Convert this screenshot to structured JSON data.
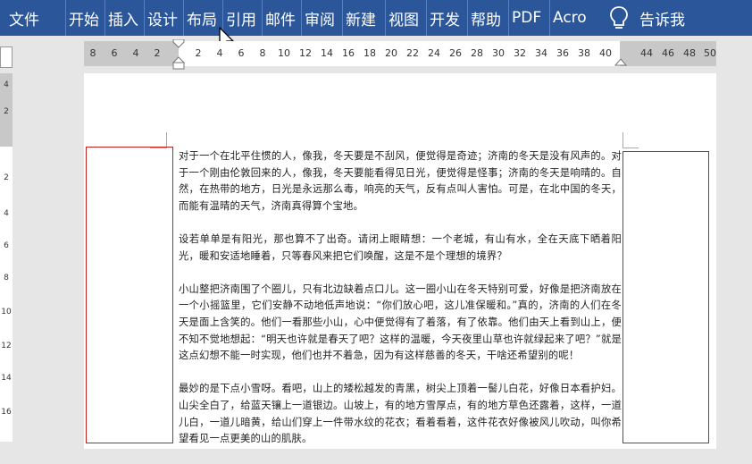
{
  "ribbon": {
    "tabs": [
      "文件",
      "开始",
      "插入",
      "设计",
      "布局",
      "引用",
      "邮件",
      "审阅",
      "新建",
      "视图",
      "开发",
      "帮助",
      "PDF",
      "Acro"
    ],
    "tell_me": "告诉我"
  },
  "ruler": {
    "horizontal_ticks": [
      "8",
      "6",
      "4",
      "2",
      "2",
      "4",
      "6",
      "8",
      "10",
      "12",
      "14",
      "16",
      "18",
      "20",
      "22",
      "24",
      "26",
      "28",
      "30",
      "32",
      "34",
      "36",
      "38",
      "40",
      "44",
      "46",
      "48",
      "50"
    ],
    "vertical_ticks": [
      "4",
      "2",
      "2",
      "4",
      "6",
      "8",
      "10",
      "12",
      "14",
      "16"
    ]
  },
  "document": {
    "paragraphs": [
      "对于一个在北平住惯的人，像我，冬天要是不刮风，便觉得是奇迹；济南的冬天是没有风声的。对于一个刚由伦敦回来的人，像我，冬天要能看得见日光，便觉得是怪事；济南的冬天是响晴的。自然，在热带的地方，日光是永远那么毒，响亮的天气，反有点叫人害怕。可是，在北中国的冬天，而能有温晴的天气，济南真得算个宝地。",
      "设若单单是有阳光，那也算不了出奇。请闭上眼睛想：一个老城，有山有水，全在天底下晒着阳光，暖和安适地睡着，只等春风来把它们唤醒，这是不是个理想的境界？",
      "小山整把济南围了个圈儿，只有北边缺着点口儿。这一圈小山在冬天特别可爱，好像是把济南放在一个小摇篮里，它们安静不动地低声地说：“你们放心吧，这儿准保暖和。”真的，济南的人们在冬天是面上含笑的。他们一看那些小山，心中便觉得有了着落，有了依靠。他们由天上看到山上，便不知不觉地想起：“明天也许就是春天了吧？这样的温暖，今天夜里山草也许就绿起来了吧？”就是这点幻想不能一时实现，他们也并不着急，因为有这样慈善的冬天，干啥还希望别的呢！",
      "最妙的是下点小雪呀。看吧，山上的矮松越发的青黑，树尖上顶着一髻儿白花，好像日本看护妇。山尖全白了，给蓝天镶上一道银边。山坡上，有的地方雪厚点，有的地方草色还露着，这样，一道儿白，一道儿暗黄，给山们穿上一件带水纹的花衣；看着看着，这件花衣好像被风儿吹动，叫你希望看见一点更美的山的肌肤。"
    ]
  }
}
